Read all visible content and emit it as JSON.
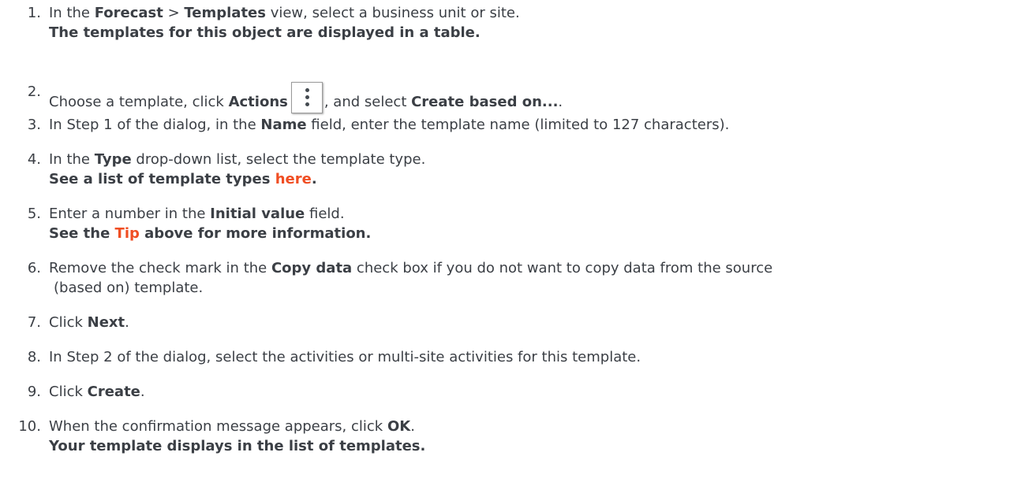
{
  "steps": [
    {
      "number": "1.",
      "line_a": "In the ",
      "forecast": "Forecast",
      "sep": " > ",
      "templates": "Templates",
      "line_b": " view, select a business unit or site.",
      "sub": "The templates for this object are displayed in a table."
    },
    {
      "number": "2.",
      "line_a": "Choose a template, click ",
      "actions": "Actions",
      "actions_icon": "vertical-ellipsis-icon",
      "line_b": ", and select ",
      "create_based_on": "Create based on...",
      "line_c": "."
    },
    {
      "number": "3.",
      "line_a": "In Step 1 of the dialog, in the ",
      "name": "Name",
      "line_b": " field, enter the template name (limited to 127 characters)."
    },
    {
      "number": "4.",
      "line_a": "In the ",
      "type": "Type",
      "line_b": " drop-down list, select the template type.",
      "sub_a": "See a list of template types ",
      "link": "here",
      "sub_b": "."
    },
    {
      "number": "5.",
      "line_a": "Enter a number in the ",
      "initial_value": "Initial value",
      "line_b": " field.",
      "sub_a": "See the ",
      "link": "Tip",
      "sub_b": " above for more information."
    },
    {
      "number": "6.",
      "line_a": "Remove the check mark in the ",
      "copy_data": "Copy data",
      "line_b": " check box if you do not want to copy data from the source",
      "line_2": "(based on) template."
    },
    {
      "number": "7.",
      "line_a": "Click ",
      "next": "Next",
      "line_b": "."
    },
    {
      "number": "8.",
      "line_a": "In Step 2 of the dialog, select the activities or multi-site activities for this template."
    },
    {
      "number": "9.",
      "line_a": "Click ",
      "create": "Create",
      "line_b": "."
    },
    {
      "number": "10.",
      "line_a": "When the confirmation message appears, click ",
      "ok": "OK",
      "line_b": ".",
      "sub": "Your template displays in the list of templates."
    }
  ],
  "colors": {
    "text": "#3b3f45",
    "link": "#f04e23"
  }
}
